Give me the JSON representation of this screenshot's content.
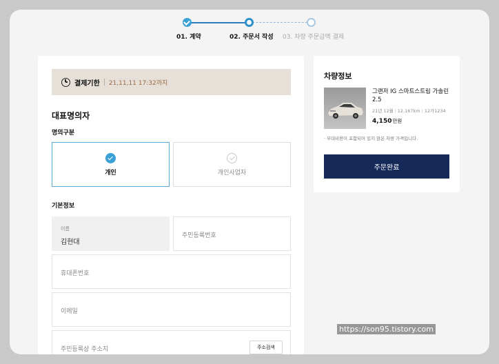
{
  "stepper": {
    "steps": [
      {
        "label": "01. 계약"
      },
      {
        "label": "02. 주문서 작성"
      },
      {
        "label": "03. 차량 주문금액 결제"
      }
    ]
  },
  "deadline": {
    "label": "결제기한",
    "value": "21,11,11 17:32까지"
  },
  "representative": {
    "title": "대표명의자",
    "ownership_label": "명의구분",
    "options": [
      {
        "label": "개인",
        "selected": true
      },
      {
        "label": "개인사업자",
        "selected": false
      }
    ]
  },
  "basic_info": {
    "title": "기본정보",
    "name": {
      "caption": "이름",
      "value": "김현대"
    },
    "rrn_placeholder": "주민등록번호",
    "phone_placeholder": "휴대폰번호",
    "email_placeholder": "이메일",
    "address_placeholder": "주민등록상 주소지",
    "address_button": "주소검색"
  },
  "vehicle": {
    "title": "차량정보",
    "name": "그랜저 IG 스마트스트림 가솔린 2.5",
    "year": "21년 12월",
    "mileage": "12,167km",
    "plate": "12가1234",
    "price": "4,150",
    "price_unit": "만원",
    "note": "· 부대비용이 포함되어 있지 않은 차량 가격입니다.",
    "order_button": "주문완료"
  },
  "watermark": "https://son95.tistory.com",
  "colors": {
    "accent": "#3aa0d6",
    "primary_button": "#162a5a",
    "deadline_bg": "#e6e0d9",
    "deadline_value": "#9a6a44"
  }
}
